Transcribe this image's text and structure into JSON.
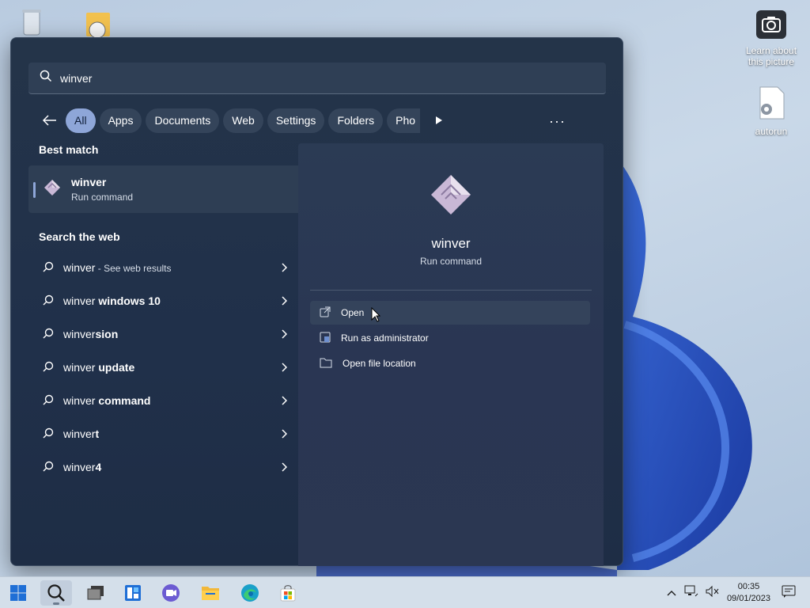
{
  "desktop": {
    "icons": [
      {
        "label": "Learn about this picture",
        "icon": "camera-icon"
      },
      {
        "label": "autorun",
        "icon": "settings-file-icon"
      }
    ]
  },
  "search": {
    "query": "winver",
    "icon": "search-icon"
  },
  "filters": {
    "back_icon": "arrow-left-icon",
    "chips": [
      "All",
      "Apps",
      "Documents",
      "Web",
      "Settings",
      "Folders",
      "Pho"
    ],
    "active": "All",
    "play_icon": "play-icon",
    "more": "···"
  },
  "best_match": {
    "title": "Best match",
    "name": "winver",
    "type": "Run command"
  },
  "web": {
    "title": "Search the web",
    "items": [
      {
        "bold": "winver",
        "rest": "",
        "suffix": " - See web results"
      },
      {
        "bold": "winver",
        "rest": " windows 10",
        "suffix": ""
      },
      {
        "bold": "winver",
        "rest": "sion",
        "suffix": ""
      },
      {
        "bold": "winver",
        "rest": " update",
        "suffix": ""
      },
      {
        "bold": "winver",
        "rest": " command",
        "suffix": ""
      },
      {
        "bold": "winver",
        "rest": "t",
        "suffix": ""
      },
      {
        "bold": "winver",
        "rest": "4",
        "suffix": ""
      }
    ]
  },
  "detail": {
    "name": "winver",
    "type": "Run command",
    "actions": [
      {
        "label": "Open",
        "icon": "open-external-icon"
      },
      {
        "label": "Run as administrator",
        "icon": "shield-admin-icon"
      },
      {
        "label": "Open file location",
        "icon": "folder-icon"
      }
    ]
  },
  "taskbar": {
    "apps": [
      "start-icon",
      "search-icon",
      "task-view-icon",
      "widgets-icon",
      "chat-icon",
      "file-explorer-icon",
      "edge-icon",
      "store-icon"
    ],
    "time": "00:35",
    "date": "09/01/2023"
  },
  "colors": {
    "accent": "#8ea6d8",
    "panel": "#243449"
  }
}
